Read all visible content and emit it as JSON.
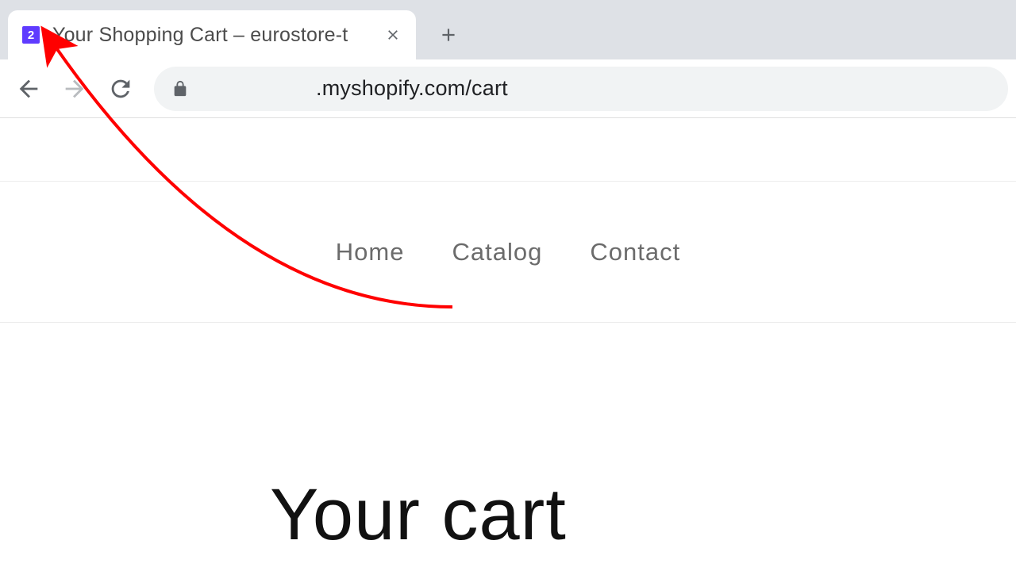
{
  "browser": {
    "tab": {
      "favicon_badge": "2",
      "title": "Your Shopping Cart – eurostore-t"
    },
    "url": ".myshopify.com/cart"
  },
  "site": {
    "nav": {
      "items": [
        {
          "label": "Home"
        },
        {
          "label": "Catalog"
        },
        {
          "label": "Contact"
        }
      ]
    },
    "heading": "Your cart"
  },
  "annotation": {
    "color": "#ff0000"
  }
}
